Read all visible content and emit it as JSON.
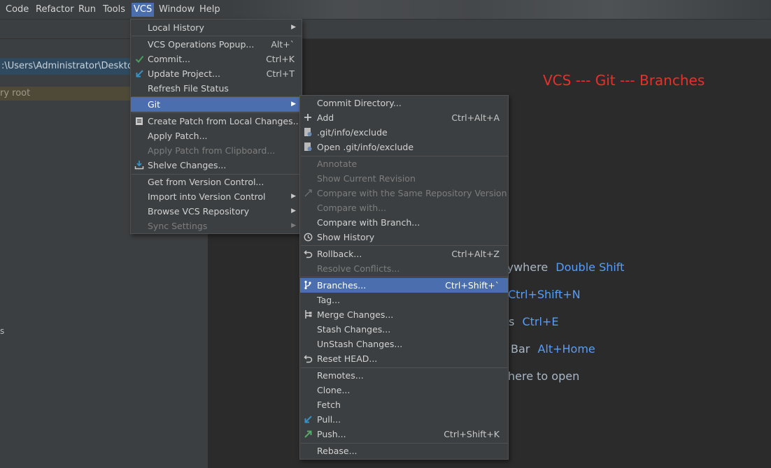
{
  "menubar": {
    "items": [
      "Code",
      "Refactor",
      "Run",
      "Tools",
      "VCS",
      "Window",
      "Help"
    ],
    "active": "VCS"
  },
  "project_panel": {
    "path": ":\\Users\\Administrator\\Desktop\\",
    "root_label": "ry root",
    "edge_glyph": "s"
  },
  "annotation": "VCS --- Git --- Branches",
  "welcome_hints": [
    {
      "text": "rywhere",
      "key": "Double Shift"
    },
    {
      "text": "",
      "key": "Ctrl+Shift+N"
    },
    {
      "text": "s",
      "key": "Ctrl+E"
    },
    {
      "text": "Bar",
      "key": "Alt+Home"
    },
    {
      "text": "here to open",
      "key": ""
    }
  ],
  "vcs_menu": {
    "items": [
      {
        "label": "Local History",
        "shortcut": "",
        "submenu": true,
        "icon": "",
        "state": "normal"
      },
      {
        "label": "VCS Operations Popup...",
        "shortcut": "Alt+`",
        "submenu": false,
        "icon": "",
        "state": "normal"
      },
      {
        "label": "Commit...",
        "shortcut": "Ctrl+K",
        "submenu": false,
        "icon": "check-icon",
        "state": "normal"
      },
      {
        "label": "Update Project...",
        "shortcut": "Ctrl+T",
        "submenu": false,
        "icon": "update-arrow-icon",
        "state": "normal"
      },
      {
        "label": "Refresh File Status",
        "shortcut": "",
        "submenu": false,
        "icon": "",
        "state": "normal"
      },
      {
        "label": "Git",
        "shortcut": "",
        "submenu": true,
        "icon": "",
        "state": "selected"
      },
      {
        "label": "Create Patch from Local Changes...",
        "shortcut": "",
        "submenu": false,
        "icon": "patch-icon",
        "state": "normal"
      },
      {
        "label": "Apply Patch...",
        "shortcut": "",
        "submenu": false,
        "icon": "",
        "state": "normal"
      },
      {
        "label": "Apply Patch from Clipboard...",
        "shortcut": "",
        "submenu": false,
        "icon": "",
        "state": "disabled"
      },
      {
        "label": "Shelve Changes...",
        "shortcut": "",
        "submenu": false,
        "icon": "shelve-icon",
        "state": "normal"
      },
      {
        "label": "Get from Version Control...",
        "shortcut": "",
        "submenu": false,
        "icon": "",
        "state": "normal"
      },
      {
        "label": "Import into Version Control",
        "shortcut": "",
        "submenu": true,
        "icon": "",
        "state": "normal"
      },
      {
        "label": "Browse VCS Repository",
        "shortcut": "",
        "submenu": true,
        "icon": "",
        "state": "normal"
      },
      {
        "label": "Sync Settings",
        "shortcut": "",
        "submenu": true,
        "icon": "",
        "state": "disabled"
      }
    ]
  },
  "git_menu": {
    "items": [
      {
        "label": "Commit Directory...",
        "shortcut": "",
        "icon": "",
        "state": "normal"
      },
      {
        "label": "Add",
        "shortcut": "Ctrl+Alt+A",
        "icon": "plus-icon",
        "state": "normal"
      },
      {
        "label": ".git/info/exclude",
        "shortcut": "",
        "icon": "git-file-icon",
        "state": "normal"
      },
      {
        "label": "Open .git/info/exclude",
        "shortcut": "",
        "icon": "git-file-icon",
        "state": "normal"
      },
      {
        "label": "Annotate",
        "shortcut": "",
        "icon": "",
        "state": "disabled"
      },
      {
        "label": "Show Current Revision",
        "shortcut": "",
        "icon": "",
        "state": "disabled"
      },
      {
        "label": "Compare with the Same Repository Version",
        "shortcut": "",
        "icon": "compare-icon",
        "state": "disabled"
      },
      {
        "label": "Compare with...",
        "shortcut": "",
        "icon": "",
        "state": "disabled"
      },
      {
        "label": "Compare with Branch...",
        "shortcut": "",
        "icon": "",
        "state": "normal"
      },
      {
        "label": "Show History",
        "shortcut": "",
        "icon": "clock-icon",
        "state": "normal"
      },
      {
        "label": "Rollback...",
        "shortcut": "Ctrl+Alt+Z",
        "icon": "rollback-icon",
        "state": "normal"
      },
      {
        "label": "Resolve Conflicts...",
        "shortcut": "",
        "icon": "",
        "state": "disabled"
      },
      {
        "label": "Branches...",
        "shortcut": "Ctrl+Shift+`",
        "icon": "branch-icon",
        "state": "selected"
      },
      {
        "label": "Tag...",
        "shortcut": "",
        "icon": "",
        "state": "normal"
      },
      {
        "label": "Merge Changes...",
        "shortcut": "",
        "icon": "merge-icon",
        "state": "normal"
      },
      {
        "label": "Stash Changes...",
        "shortcut": "",
        "icon": "",
        "state": "normal"
      },
      {
        "label": "UnStash Changes...",
        "shortcut": "",
        "icon": "",
        "state": "normal"
      },
      {
        "label": "Reset HEAD...",
        "shortcut": "",
        "icon": "reset-icon",
        "state": "normal"
      },
      {
        "label": "Remotes...",
        "shortcut": "",
        "icon": "",
        "state": "normal"
      },
      {
        "label": "Clone...",
        "shortcut": "",
        "icon": "",
        "state": "normal"
      },
      {
        "label": "Fetch",
        "shortcut": "",
        "icon": "",
        "state": "normal"
      },
      {
        "label": "Pull...",
        "shortcut": "",
        "icon": "pull-icon",
        "state": "normal"
      },
      {
        "label": "Push...",
        "shortcut": "Ctrl+Shift+K",
        "icon": "push-icon",
        "state": "normal"
      },
      {
        "label": "Rebase...",
        "shortcut": "",
        "icon": "",
        "state": "normal"
      }
    ]
  },
  "colors": {
    "selection": "#4b6eaf",
    "annotation": "#e8302a",
    "shortcut_key": "#589df6",
    "commit_check": "#4aa05a",
    "update_arrow": "#3592c4",
    "push_arrow": "#59a869"
  }
}
